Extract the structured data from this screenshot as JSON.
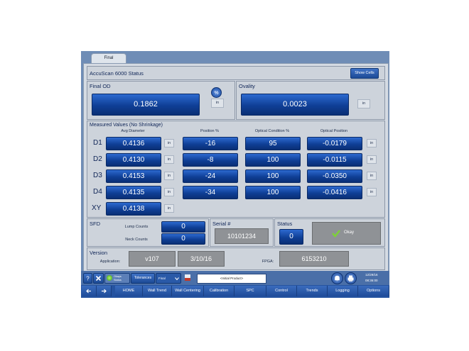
{
  "tab": "Final",
  "header": {
    "title": "AccuScan 6000 Status",
    "show_cells": "Show Cells"
  },
  "final_od": {
    "label": "Final OD",
    "value": "0.1862",
    "unit": "in"
  },
  "ovality": {
    "label": "Ovality",
    "value": "0.0023",
    "unit": "in"
  },
  "measured": {
    "label": "Measured Values (No Shrinkage)",
    "headers": {
      "avg_diameter": "Avg Diameter",
      "position": "Position %",
      "optical_condition": "Optical Condition %",
      "optical_position": "Optical Position"
    },
    "rows": [
      {
        "label": "D1",
        "avg": "0.4136",
        "avg_unit": "in",
        "pos": "-16",
        "cond": "95",
        "opos": "-0.0179",
        "opos_unit": "in"
      },
      {
        "label": "D2",
        "avg": "0.4130",
        "avg_unit": "in",
        "pos": "-8",
        "cond": "100",
        "opos": "-0.0115",
        "opos_unit": "in"
      },
      {
        "label": "D3",
        "avg": "0.4153",
        "avg_unit": "in",
        "pos": "-24",
        "cond": "100",
        "opos": "-0.0350",
        "opos_unit": "in"
      },
      {
        "label": "D4",
        "avg": "0.4135",
        "avg_unit": "in",
        "pos": "-34",
        "cond": "100",
        "opos": "-0.0416",
        "opos_unit": "in"
      }
    ],
    "xy": {
      "label": "XY",
      "value": "0.4138",
      "unit": "in"
    }
  },
  "sfd": {
    "label": "SFD",
    "lump_label": "Lump Counts",
    "lump_value": "0",
    "neck_label": "Neck Counts",
    "neck_value": "0"
  },
  "serial": {
    "label": "Serial #",
    "value": "10101234"
  },
  "status": {
    "label": "Status",
    "value": "0",
    "ok": "Okay"
  },
  "version": {
    "label": "Version",
    "app_label": "Application:",
    "app_version": "v107",
    "date": "3/10/16",
    "fpga_label": "FPGA:",
    "fpga_value": "6153210"
  },
  "statusbar": {
    "tolerances": "Tolerances",
    "product": "<Initial Product>",
    "date": "12/29/16",
    "time": "08:36:00",
    "status_text": "Okays Status",
    "select": "Final"
  },
  "nav": [
    "HOME",
    "Wall Trend",
    "Wall Centering",
    "Calibration",
    "SPC",
    "Control",
    "Trends",
    "Logging",
    "Options"
  ],
  "colors": {
    "accent": "#1f58bd",
    "nav": "#2553a0",
    "panel": "#cdd3db"
  }
}
